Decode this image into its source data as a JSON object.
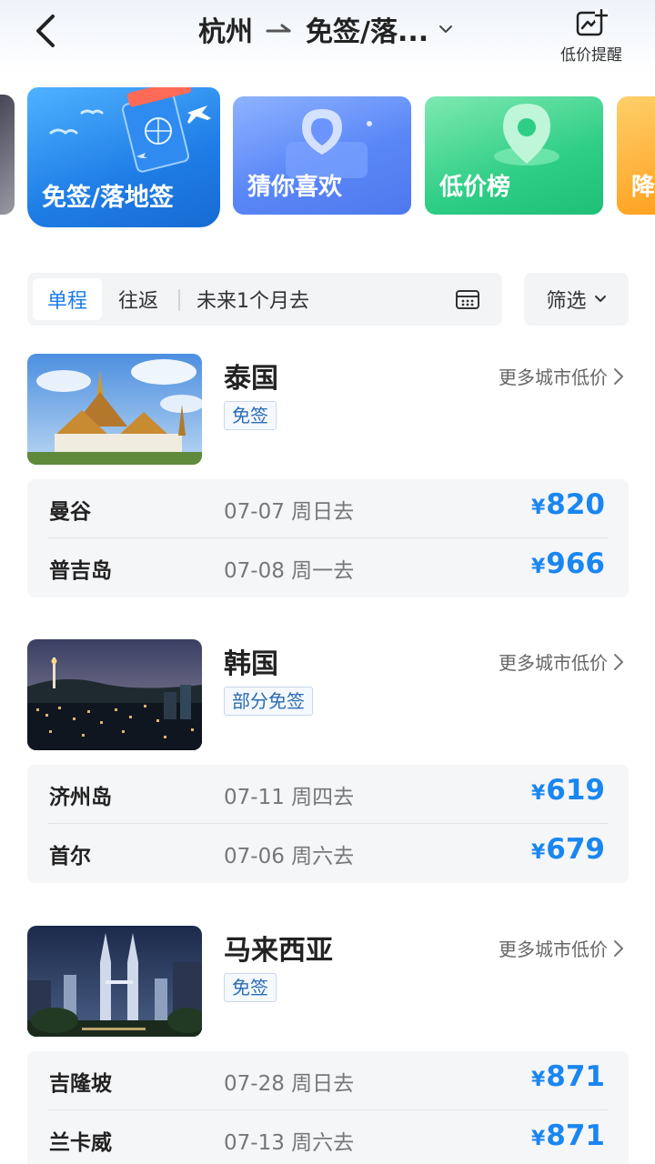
{
  "header": {
    "from": "杭州",
    "destination": "免签/落...",
    "alert_label": "低价提醒"
  },
  "categories": [
    {
      "label": "免签/落地签"
    },
    {
      "label": "猜你喜欢"
    },
    {
      "label": "低价榜"
    },
    {
      "label": "降"
    }
  ],
  "filter": {
    "one_way": "单程",
    "round_trip": "往返",
    "date_range": "未来1个月去",
    "filter_label": "筛选"
  },
  "more_label": "更多城市低价",
  "currency": "¥",
  "countries": [
    {
      "name": "泰国",
      "tag": "免签",
      "rows": [
        {
          "city": "曼谷",
          "date": "07-07 周日去",
          "price": "820"
        },
        {
          "city": "普吉岛",
          "date": "07-08 周一去",
          "price": "966"
        }
      ]
    },
    {
      "name": "韩国",
      "tag": "部分免签",
      "rows": [
        {
          "city": "济州岛",
          "date": "07-11 周四去",
          "price": "619"
        },
        {
          "city": "首尔",
          "date": "07-06 周六去",
          "price": "679"
        }
      ]
    },
    {
      "name": "马来西亚",
      "tag": "免签",
      "rows": [
        {
          "city": "吉隆坡",
          "date": "07-28 周日去",
          "price": "871"
        },
        {
          "city": "兰卡威",
          "date": "07-13 周六去",
          "price": "871"
        }
      ]
    }
  ],
  "colors": {
    "accent": "#1a7df0",
    "price": "#1a86f0",
    "tag_text": "#2a6cb4"
  }
}
